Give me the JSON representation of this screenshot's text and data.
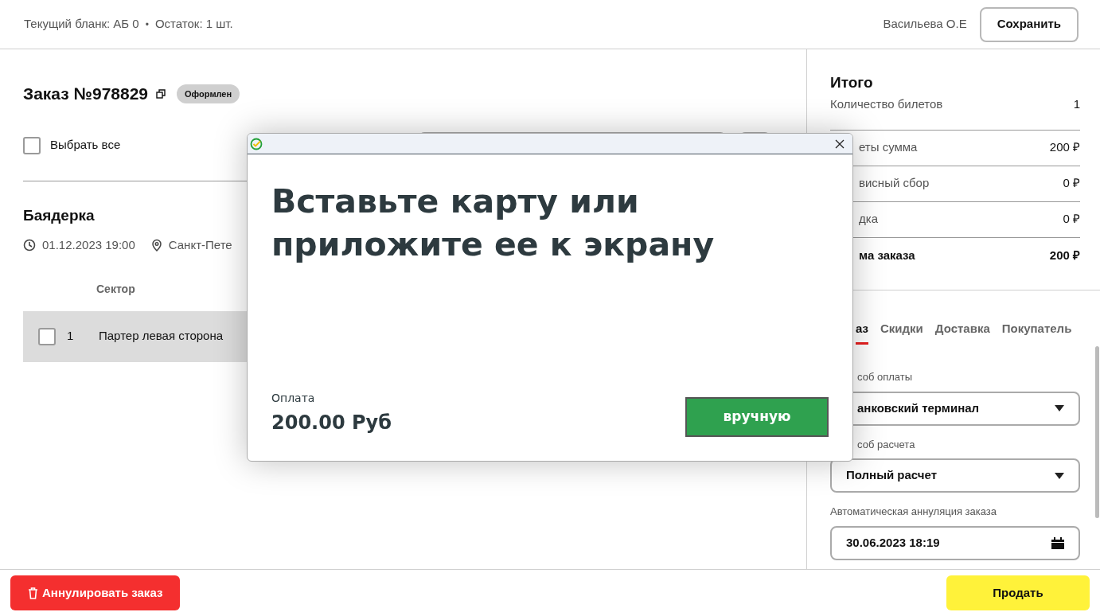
{
  "header": {
    "blank": "Текущий бланк: АБ 0",
    "separator": "•",
    "remaining": "Остаток: 1 шт.",
    "user": "Васильева О.Е",
    "save_button": "Сохранить"
  },
  "order": {
    "title": "Заказ №978829",
    "status": "Оформлен",
    "select_all": {
      "label": "Выбрать все",
      "checked": false
    }
  },
  "event": {
    "title": "Баядерка",
    "datetime": "01.12.2023 19:00",
    "place": "Санкт-Пете"
  },
  "table": {
    "columns": [
      "Сектор"
    ],
    "rows": [
      {
        "checked": false,
        "number": "1",
        "sector": "Партер левая сторона"
      }
    ]
  },
  "summary": {
    "title": "Итого",
    "rows": [
      {
        "label": "Количество билетов",
        "value": "1",
        "bold": false
      },
      {
        "label": "еты сумма",
        "value": "200 ₽",
        "bold": false
      },
      {
        "label": "висный сбор",
        "value": "0 ₽",
        "bold": false
      },
      {
        "label": "дка",
        "value": "0 ₽",
        "bold": false
      },
      {
        "label": "ма заказа",
        "value": "200 ₽",
        "bold": true
      }
    ]
  },
  "tabs": [
    {
      "label": "аз",
      "selected": true
    },
    {
      "label": "Скидки",
      "selected": false
    },
    {
      "label": "Доставка",
      "selected": false
    },
    {
      "label": "Покупатель",
      "selected": false
    }
  ],
  "fields": [
    {
      "kind": "select",
      "label": "соб оплаты",
      "value": "анковский терминал"
    },
    {
      "kind": "select",
      "label": "соб расчета",
      "value": "Полный расчет"
    },
    {
      "kind": "date",
      "label": "Автоматическая аннуляция заказа",
      "value": "30.06.2023 18:19"
    }
  ],
  "footer": {
    "cancel_button": "Аннулировать заказ",
    "sell_button": "Продать"
  },
  "dialog": {
    "message": "Вставьте карту или приложите ее к экрану",
    "payment_label": "Оплата",
    "amount": "200.00 Руб",
    "manual_button": "вручную"
  }
}
